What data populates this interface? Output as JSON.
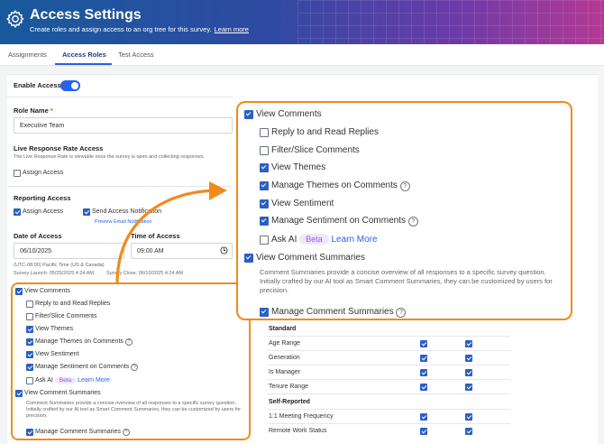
{
  "header": {
    "title": "Access Settings",
    "subtitle": "Create roles and assign access to an org tree for this survey.",
    "learn_more": "Learn more",
    "icon": "gear-icon"
  },
  "tabs": [
    {
      "label": "Assignments",
      "active": false
    },
    {
      "label": "Access Roles",
      "active": true
    },
    {
      "label": "Test Access",
      "active": false
    }
  ],
  "form": {
    "enable_access": "Enable Access",
    "enable_access_on": true,
    "role_name_label": "Role Name",
    "role_name_required": "*",
    "role_name_value": "Executive Team",
    "live_rate_label": "Live Response Rate Access",
    "live_rate_desc": "The Live Response Rate is viewable once the survey is open and collecting responses.",
    "assign_access": "Assign Access",
    "reporting_label": "Reporting Access",
    "send_notification": "Send Access Notification",
    "preview_email": "Preview Email Notification",
    "date_label": "Date of Access",
    "date_value": "06/10/2025",
    "time_label": "Time of Access",
    "time_value": "09:00 AM",
    "timezone": "(UTC-08:00) Pacific Time (US & Canada)",
    "survey_launch": "Survey Launch: 05/25/2025 4:24 AM",
    "survey_close": "Survey Close: 06/10/2025 4:24 AM"
  },
  "comments": {
    "view_comments": "View Comments",
    "reply": "Reply to and Read Replies",
    "filter": "Filter/Slice Comments",
    "view_themes": "View Themes",
    "manage_themes": "Manage Themes on Comments",
    "view_sentiment": "View Sentiment",
    "manage_sentiment": "Manage Sentiment on Comments",
    "ask_ai": "Ask AI",
    "beta": "Beta",
    "learn_more": "Learn More",
    "view_summaries": "View Comment Summaries",
    "summaries_desc": "Comment Summaries provide a concise overview of all responses to a specific survey question. Initially crafted by our AI tool as Smart Comment Summaries, they can be customized by users for precision.",
    "manage_summaries": "Manage Comment Summaries",
    "help": "?"
  },
  "table": {
    "groups": [
      {
        "name": "Standard",
        "rows": [
          "Age Range",
          "Generation",
          "Is Manager",
          "Tenure Range"
        ]
      },
      {
        "name": "Self-Reported",
        "rows": [
          "1:1 Meeting Frequency",
          "Remote Work Status"
        ]
      }
    ]
  },
  "colors": {
    "accent": "#2563eb",
    "highlight": "#f28a1a",
    "checkbox": "#2b5fc4"
  }
}
